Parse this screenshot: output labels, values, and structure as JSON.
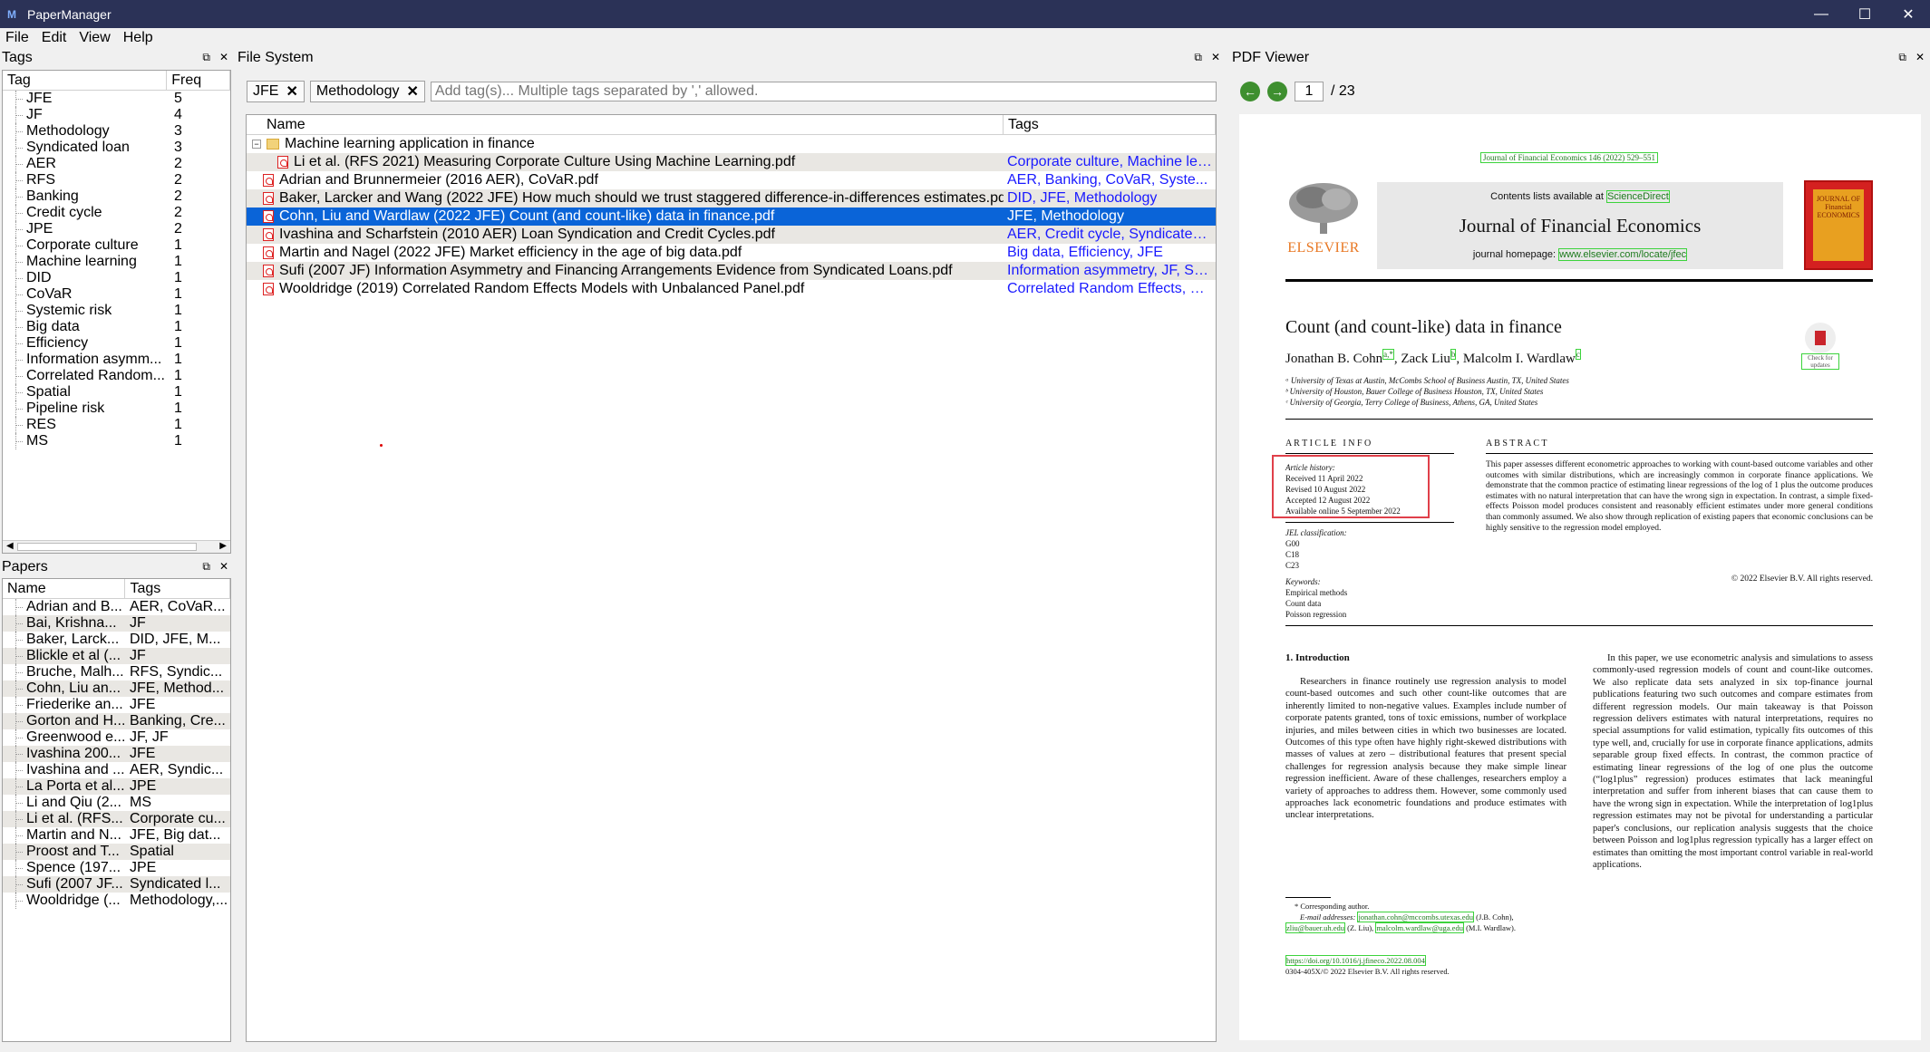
{
  "window": {
    "title": "PaperManager",
    "controls": [
      "minimize",
      "maximize",
      "close"
    ]
  },
  "menu": [
    "File",
    "Edit",
    "View",
    "Help"
  ],
  "tags_panel": {
    "title": "Tags",
    "columns": [
      "Tag",
      "Freq"
    ],
    "rows": [
      {
        "tag": "JFE",
        "freq": "5"
      },
      {
        "tag": "JF",
        "freq": "4"
      },
      {
        "tag": "Methodology",
        "freq": "3"
      },
      {
        "tag": "Syndicated loan",
        "freq": "3"
      },
      {
        "tag": "AER",
        "freq": "2"
      },
      {
        "tag": "RFS",
        "freq": "2"
      },
      {
        "tag": "Banking",
        "freq": "2"
      },
      {
        "tag": "Credit cycle",
        "freq": "2"
      },
      {
        "tag": "JPE",
        "freq": "2"
      },
      {
        "tag": "Corporate culture",
        "freq": "1"
      },
      {
        "tag": "Machine learning",
        "freq": "1"
      },
      {
        "tag": "DID",
        "freq": "1"
      },
      {
        "tag": "CoVaR",
        "freq": "1"
      },
      {
        "tag": "Systemic risk",
        "freq": "1"
      },
      {
        "tag": "Big data",
        "freq": "1"
      },
      {
        "tag": "Efficiency",
        "freq": "1"
      },
      {
        "tag": "Information asymm...",
        "freq": "1"
      },
      {
        "tag": "Correlated Random...",
        "freq": "1"
      },
      {
        "tag": "Spatial",
        "freq": "1"
      },
      {
        "tag": "Pipeline risk",
        "freq": "1"
      },
      {
        "tag": "RES",
        "freq": "1"
      },
      {
        "tag": "MS",
        "freq": "1"
      }
    ]
  },
  "papers_panel": {
    "title": "Papers",
    "columns": [
      "Name",
      "Tags"
    ],
    "rows": [
      {
        "name": "Adrian and B...",
        "tags": "AER, CoVaR..."
      },
      {
        "name": "Bai, Krishna...",
        "tags": "JF"
      },
      {
        "name": "Baker, Larck...",
        "tags": "DID, JFE, M..."
      },
      {
        "name": "Blickle et al (...",
        "tags": "JF"
      },
      {
        "name": "Bruche, Malh...",
        "tags": "RFS, Syndic..."
      },
      {
        "name": "Cohn, Liu an...",
        "tags": "JFE, Method..."
      },
      {
        "name": "Friederike an...",
        "tags": "JFE"
      },
      {
        "name": "Gorton and H...",
        "tags": "Banking, Cre..."
      },
      {
        "name": "Greenwood e...",
        "tags": "JF, JF"
      },
      {
        "name": "Ivashina 200...",
        "tags": "JFE"
      },
      {
        "name": "Ivashina and ...",
        "tags": "AER, Syndic..."
      },
      {
        "name": "La Porta et al...",
        "tags": "JPE"
      },
      {
        "name": "Li and Qiu (2...",
        "tags": "MS"
      },
      {
        "name": "Li et al. (RFS...",
        "tags": "Corporate cu..."
      },
      {
        "name": "Martin and N...",
        "tags": "JFE, Big dat..."
      },
      {
        "name": "Proost and T...",
        "tags": "Spatial"
      },
      {
        "name": "Spence (197...",
        "tags": "JPE"
      },
      {
        "name": "Sufi (2007 JF...",
        "tags": "Syndicated l..."
      },
      {
        "name": "Wooldridge (...",
        "tags": "Methodology,..."
      }
    ]
  },
  "file_system": {
    "title": "File System",
    "filter_tags": [
      "JFE",
      "Methodology"
    ],
    "tag_placeholder": "Add tag(s)... Multiple tags separated by ',' allowed.",
    "columns": [
      "Name",
      "Tags"
    ],
    "folder": "Machine learning application in finance",
    "rows": [
      {
        "name": "Li et al. (RFS 2021) Measuring Corporate Culture Using Machine Learning.pdf",
        "tags": "Corporate culture, Machine lea...",
        "child": true
      },
      {
        "name": "Adrian and Brunnermeier (2016 AER), CoVaR.pdf",
        "tags": "AER, Banking, CoVaR, Syste..."
      },
      {
        "name": "Baker, Larcker and Wang (2022 JFE) How much should we trust staggered difference-in-differences estimates.pdf",
        "tags": "DID, JFE, Methodology"
      },
      {
        "name": "Cohn, Liu and Wardlaw (2022 JFE) Count (and count-like) data in finance.pdf",
        "tags": "JFE, Methodology",
        "selected": true
      },
      {
        "name": "Ivashina and Scharfstein (2010 AER) Loan Syndication and Credit Cycles.pdf",
        "tags": "AER, Credit cycle, Syndicated ..."
      },
      {
        "name": "Martin and Nagel (2022 JFE) Market efficiency in the age of big data.pdf",
        "tags": "Big data, Efficiency, JFE"
      },
      {
        "name": "Sufi (2007 JF) Information Asymmetry and Financing Arrangements  Evidence from Syndicated Loans.pdf",
        "tags": "Information asymmetry, JF, Syn..."
      },
      {
        "name": "Wooldridge (2019) Correlated Random Effects Models with Unbalanced Panel.pdf",
        "tags": "Correlated Random Effects, M..."
      }
    ]
  },
  "pdf_viewer": {
    "title": "PDF Viewer",
    "page_current": "1",
    "page_total": "/ 23",
    "journal_ref": "Journal of Financial Economics 146 (2022) 529–551",
    "contents_text": "Contents lists available at",
    "sciencedirect": "ScienceDirect",
    "journal_name": "Journal of Financial Economics",
    "homepage_label": "journal homepage:",
    "homepage_url": "www.elsevier.com/locate/jfec",
    "publisher": "ELSEVIER",
    "cover_title": "JOURNAL OF Financial ECONOMICS",
    "check_updates": "Check for updates",
    "article_title": "Count (and count-like) data in finance",
    "author1": "Jonathan B. Cohn",
    "author1_mark": "a,*",
    "author2": "Zack Liu",
    "author2_mark": "b",
    "author3": "Malcolm I. Wardlaw",
    "author3_mark": "c",
    "affil_a": "ᵃ University of Texas at Austin, McCombs School of Business Austin, TX, United States",
    "affil_b": "ᵇ University of Houston, Bauer College of Business Houston, TX, United States",
    "affil_c": "ᶜ University of Georgia, Terry College of Business, Athens, GA, United States",
    "article_info_heading": "A R T I C L E   I N F O",
    "abstract_heading": "A B S T R A C T",
    "history_label": "Article history:",
    "received": "Received 11 April 2022",
    "revised": "Revised 10 August 2022",
    "accepted": "Accepted 12 August 2022",
    "online": "Available online 5 September 2022",
    "jel_label": "JEL classification:",
    "jel_codes": [
      "G00",
      "C18",
      "C23"
    ],
    "keywords_label": "Keywords:",
    "keywords": [
      "Empirical methods",
      "Count data",
      "Poisson regression"
    ],
    "abstract": "This paper assesses different econometric approaches to working with count-based outcome variables and other outcomes with similar distributions, which are increasingly common in corporate finance applications. We demonstrate that the common practice of estimating linear regressions of the log of 1 plus the outcome produces estimates with no natural interpretation that can have the wrong sign in expectation. In contrast, a simple fixed-effects Poisson model produces consistent and reasonably efficient estimates under more general conditions than commonly assumed. We also show through replication of existing papers that economic conclusions can be highly sensitive to the regression model employed.",
    "copyright": "© 2022 Elsevier B.V. All rights reserved.",
    "intro_heading": "1. Introduction",
    "intro_col1": "Researchers in finance routinely use regression analysis to model count-based outcomes and such other count-like outcomes that are inherently limited to non-negative values. Examples include number of corporate patents granted, tons of toxic emissions, number of workplace injuries, and miles between cities in which two businesses are located. Outcomes of this type often have highly right-skewed distributions with masses of values at zero – distributional features that present special challenges for regression analysis because they make simple linear regression inefficient. Aware of these challenges, researchers employ a variety of approaches to address them. However, some commonly used approaches lack econometric foundations and produce estimates with unclear interpretations.",
    "intro_col2": "In this paper, we use econometric analysis and simulations to assess commonly-used regression models of count and count-like outcomes. We also replicate data sets analyzed in six top-finance journal publications featuring two such outcomes and compare estimates from different regression models. Our main takeaway is that Poisson regression delivers estimates with natural interpretations, requires no special assumptions for valid estimation, typically fits outcomes of this type well, and, crucially for use in corporate finance applications, admits separable group fixed effects. In contrast, the common practice of estimating linear regressions of the log of one plus the outcome (“log1plus” regression) produces estimates that lack meaningful interpretation and suffer from inherent biases that can cause them to have the wrong sign in expectation. While the interpretation of log1plus regression estimates may not be pivotal for understanding a particular paper's conclusions, our replication analysis suggests that the choice between Poisson and log1plus regression typically has a larger effect on estimates than omitting the most important control variable in real-world applications.",
    "corr_author": "* Corresponding author.",
    "email_label": "E-mail addresses:",
    "email1": "jonathan.cohn@mccombs.utexas.edu",
    "email1_who": "(J.B. Cohn),",
    "email2": "zliu@bauer.uh.edu",
    "email2_who": "(Z. Liu),",
    "email3": "malcolm.wardlaw@uga.edu",
    "email3_who": "(M.I. Wardlaw).",
    "doi": "https://doi.org/10.1016/j.jfineco.2022.08.004",
    "issn": "0304-405X/© 2022 Elsevier B.V. All rights reserved."
  }
}
